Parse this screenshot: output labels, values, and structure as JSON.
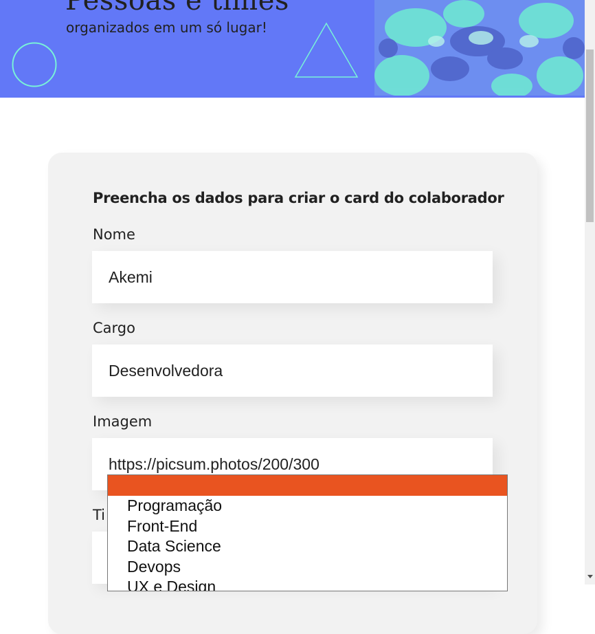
{
  "banner": {
    "title": "Pessoas e times",
    "subtitle": "organizados em um só lugar!",
    "colors": {
      "background": "#6278f7",
      "accent": "#79f2d8"
    }
  },
  "form": {
    "heading": "Preencha os dados para criar o card do colaborador",
    "fields": [
      {
        "label": "Nome",
        "value": "Akemi"
      },
      {
        "label": "Cargo",
        "value": "Desenvolvedora"
      },
      {
        "label": "Imagem",
        "value": "https://picsum.photos/200/300"
      },
      {
        "label": "Ti",
        "value": ""
      }
    ],
    "time_select": {
      "selected": "",
      "options": [
        "Programação",
        "Front-End",
        "Data Science",
        "Devops",
        "UX e Design"
      ]
    }
  }
}
